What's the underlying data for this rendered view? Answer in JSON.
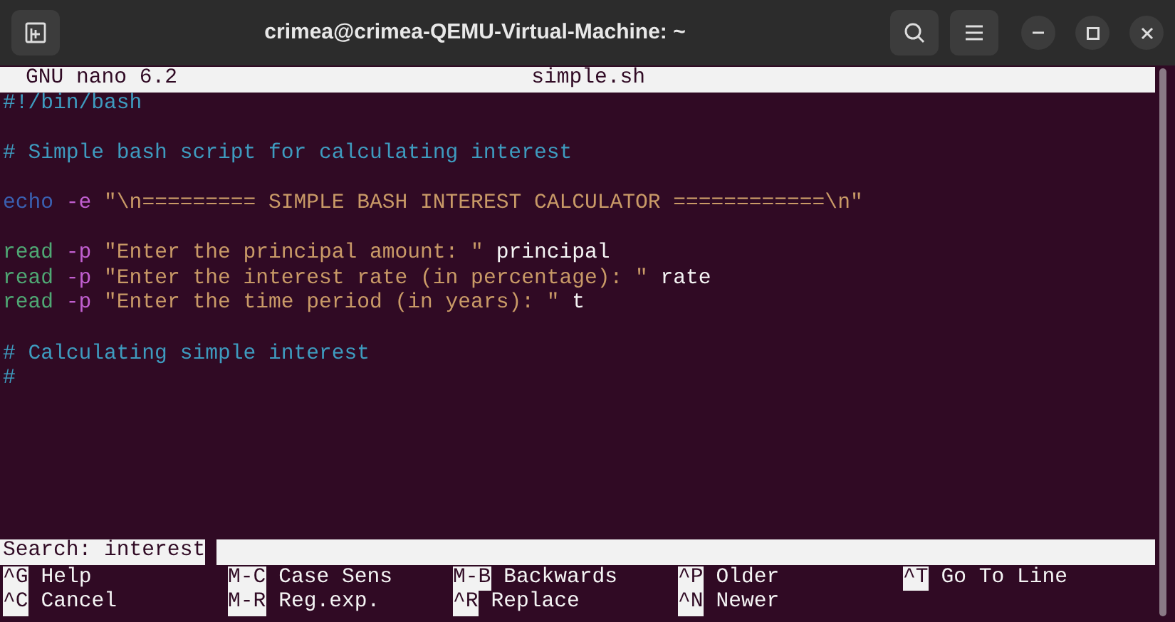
{
  "window": {
    "title": "crimea@crimea-QEMU-Virtual-Machine: ~"
  },
  "header": {
    "app": "GNU nano 6.2",
    "file": "simple.sh"
  },
  "lines": [
    {
      "kind": "code",
      "segments": [
        {
          "text": "#!/bin/bash",
          "kind": "comment"
        }
      ]
    },
    {
      "kind": "blank"
    },
    {
      "kind": "code",
      "segments": [
        {
          "text": "# Simple bash script for calculating interest",
          "kind": "comment"
        }
      ]
    },
    {
      "kind": "blank"
    },
    {
      "kind": "code",
      "segments": [
        {
          "text": "echo",
          "kind": "builtin"
        },
        {
          "text": " -e",
          "kind": "flag"
        },
        {
          "text": " \"\\n========= SIMPLE BASH INTEREST CALCULATOR ============\\n\"",
          "kind": "string"
        }
      ]
    },
    {
      "kind": "blank"
    },
    {
      "kind": "code",
      "segments": [
        {
          "text": "read",
          "kind": "command"
        },
        {
          "text": " -p",
          "kind": "flag"
        },
        {
          "text": " \"Enter the principal amount: \"",
          "kind": "string"
        },
        {
          "text": " principal",
          "kind": "plain"
        }
      ]
    },
    {
      "kind": "code",
      "segments": [
        {
          "text": "read",
          "kind": "command"
        },
        {
          "text": " -p",
          "kind": "flag"
        },
        {
          "text": " \"Enter the interest rate (in percentage): \"",
          "kind": "string"
        },
        {
          "text": " rate",
          "kind": "plain"
        }
      ]
    },
    {
      "kind": "code",
      "segments": [
        {
          "text": "read",
          "kind": "command"
        },
        {
          "text": " -p",
          "kind": "flag"
        },
        {
          "text": " \"Enter the time period (in years): \"",
          "kind": "string"
        },
        {
          "text": " t",
          "kind": "plain"
        }
      ]
    },
    {
      "kind": "blank"
    },
    {
      "kind": "code",
      "segments": [
        {
          "text": "# Calculating simple interest",
          "kind": "comment"
        }
      ]
    },
    {
      "kind": "code",
      "segments": [
        {
          "text": "#",
          "kind": "comment"
        }
      ]
    }
  ],
  "search": {
    "label": "Search: interest"
  },
  "shortcuts": [
    [
      {
        "key": "^G",
        "label": "Help"
      },
      {
        "key": "M-C",
        "label": "Case Sens"
      },
      {
        "key": "M-B",
        "label": "Backwards"
      },
      {
        "key": "^P",
        "label": "Older"
      },
      {
        "key": "^T",
        "label": "Go To Line"
      }
    ],
    [
      {
        "key": "^C",
        "label": "Cancel"
      },
      {
        "key": "M-R",
        "label": "Reg.exp."
      },
      {
        "key": "^R",
        "label": "Replace"
      },
      {
        "key": "^N",
        "label": "Newer"
      }
    ]
  ]
}
